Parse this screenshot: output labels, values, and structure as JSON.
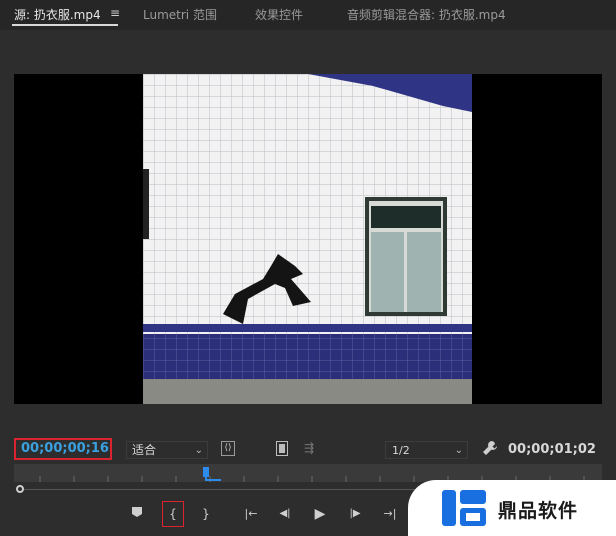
{
  "tabs": [
    {
      "label": "源: 扔衣服.mp4",
      "active": true
    },
    {
      "label": "Lumetri 范围",
      "active": false
    },
    {
      "label": "效果控件",
      "active": false
    },
    {
      "label": "音频剪辑混合器: 扔衣服.mp4",
      "active": false
    }
  ],
  "menu_icon": "≡",
  "controls": {
    "current_timecode": "00;00;00;16",
    "fit_label": "适合",
    "resolution_label": "1/2",
    "duration_timecode": "00;00;01;02"
  },
  "icons": {
    "chevron": "chevron-down-icon",
    "wrench": "wrench-icon",
    "export_frame": "export-frame-icon",
    "insert": "insert-icon",
    "overwrite": "overwrite-icon"
  },
  "transport": [
    {
      "name": "add-marker-button",
      "glyph": "⬟"
    },
    {
      "name": "mark-in-button",
      "glyph": "{"
    },
    {
      "name": "mark-out-button",
      "glyph": "}"
    },
    {
      "name": "go-to-in-button",
      "glyph": "|←"
    },
    {
      "name": "step-back-button",
      "glyph": "◀|"
    },
    {
      "name": "play-button",
      "glyph": "▶"
    },
    {
      "name": "step-forward-button",
      "glyph": "|▶"
    },
    {
      "name": "go-to-out-button",
      "glyph": "→|"
    }
  ],
  "watermark": {
    "text": "鼎品软件"
  },
  "colors": {
    "timecode_blue": "#3aa0e0",
    "highlight_red": "#d9232e",
    "playhead_blue": "#2d8ceb"
  }
}
